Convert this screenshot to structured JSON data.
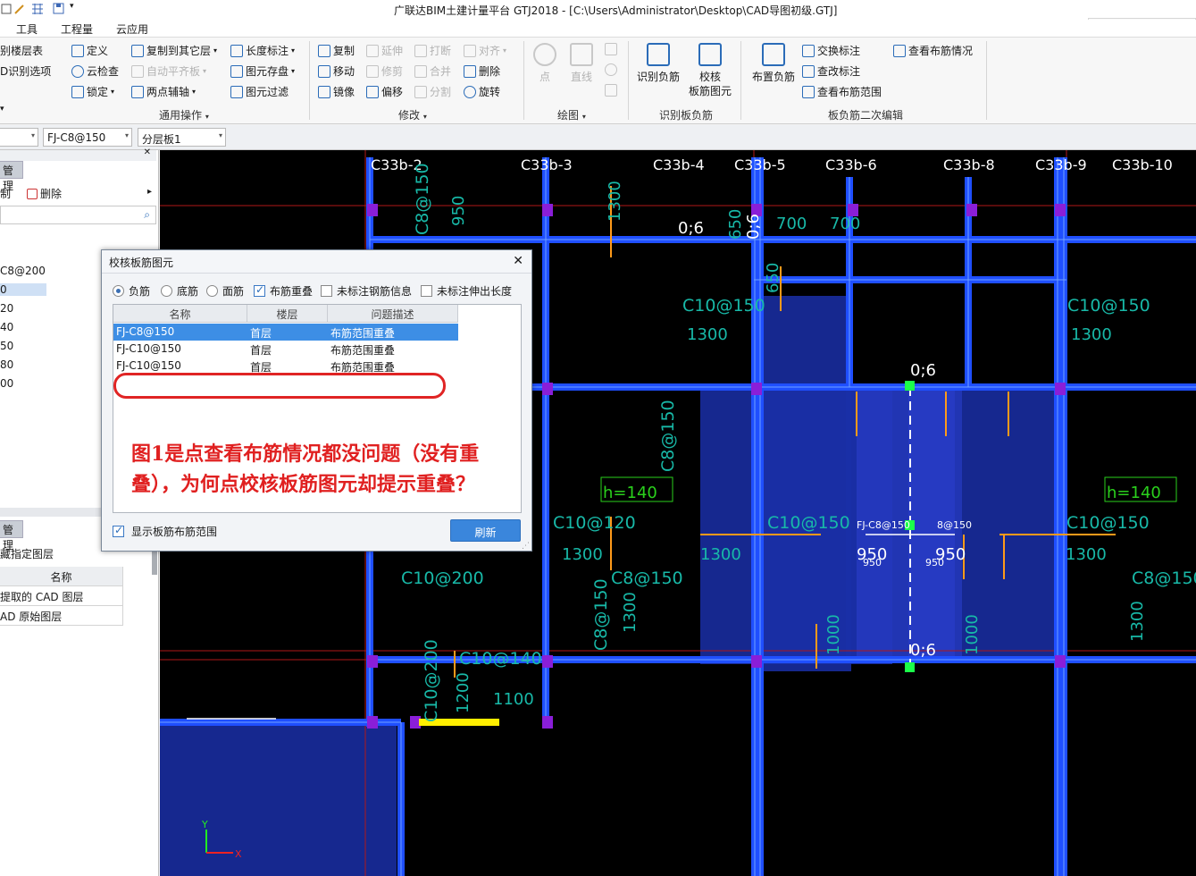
{
  "window": {
    "title": "广联达BIM土建计量平台 GTJ2018 - [C:\\Users\\Administrator\\Desktop\\CAD导图初级.GTJ]"
  },
  "menu": [
    "工具",
    "工程量",
    "云应用"
  ],
  "ribbon": {
    "left_cut": {
      "layer_table": "别楼层表",
      "cad_options": "D识别选项"
    },
    "common": {
      "define": "定义",
      "copy_to_other": "复制到其它层",
      "length_mark": "长度标注",
      "cloud_check": "云检查",
      "auto_level": "自动平齐板",
      "save_elements": "图元存盘",
      "lock": "锁定",
      "two_point_axis": "两点辅轴",
      "filter": "图元过滤",
      "group_label": "通用操作"
    },
    "modify": {
      "copy": "复制",
      "extend": "延伸",
      "break": "打断",
      "align": "对齐",
      "move": "移动",
      "trim": "修剪",
      "merge": "合并",
      "delete": "删除",
      "mirror": "镜像",
      "offset": "偏移",
      "split": "分割",
      "rotate": "旋转",
      "group_label": "修改"
    },
    "draw": {
      "point": "点",
      "line": "直线",
      "group_label": "绘图"
    },
    "identify": {
      "identify_neg": "识别负筋",
      "check_line1": "校核",
      "check_line2": "板筋图元",
      "group_label": "识别板负筋"
    },
    "secondary": {
      "place_neg": "布置负筋",
      "swap_mark": "交换标注",
      "view_layout": "查看布筋情况",
      "change_mark": "查改标注",
      "view_range": "查看布筋范围",
      "group_label": "板负筋二次编辑"
    }
  },
  "toolbar2": {
    "combo1": "",
    "combo2": "FJ-C8@150",
    "combo3": "分层板1"
  },
  "left_panel": {
    "manage_tab": "管理",
    "copy": "制",
    "delete": "删除",
    "list_items": [
      "C8@200",
      "0",
      "20",
      "40",
      "50",
      "80",
      "00"
    ],
    "selected_index": 1,
    "layer_manage_tab": "管理",
    "hide_layer": "藏指定图层",
    "grid_header": "名称",
    "grid_rows": [
      "提取的 CAD 图层",
      "AD 原始图层"
    ]
  },
  "canvas": {
    "axis_labels": [
      "C33b-2",
      "C33b-3",
      "C33b-4",
      "C33b-5",
      "C33b-6",
      "C33b-8",
      "C33b-9",
      "C33b-10"
    ],
    "labels": [
      "C8@150",
      "950",
      "1300",
      "0;6",
      "650",
      "700",
      "0;6",
      "650",
      "700",
      "C10@150",
      "1300",
      "C10@150",
      "1300",
      "0;6",
      "C8@150",
      "h=140",
      "h=140",
      "C10@120",
      "1300",
      "C10@150",
      "C10@150",
      "1300",
      "1300",
      "C10@200",
      "C8@150",
      "C8@150",
      "C8@150",
      "1300",
      "1300",
      "C10@140",
      "1100",
      "C10@200",
      "1200",
      "1000",
      "1000",
      "0;6",
      "950",
      "950",
      "FJ-C8@150",
      "8@150",
      "950",
      "950"
    ],
    "colors": {
      "background": "#000000",
      "beam": "#1f4fff",
      "slab_fill": "#1a2fa8",
      "purple": "#8a1ed8"
    },
    "axis_icon": {
      "y": "Y",
      "x": "X"
    }
  },
  "dialog": {
    "title": "校核板筋图元",
    "options": {
      "neg": "负筋",
      "bottom": "底筋",
      "face": "面筋",
      "overlap": "布筋重叠",
      "unmarked_info": "未标注钢筋信息",
      "unmarked_ext": "未标注伸出长度"
    },
    "option_states": {
      "radio_selected": "neg",
      "overlap_checked": true,
      "unmarked_info_checked": false,
      "unmarked_ext_checked": false
    },
    "headers": [
      "名称",
      "楼层",
      "问题描述"
    ],
    "rows": [
      {
        "name": "FJ-C8@150",
        "floor": "首层",
        "issue": "布筋范围重叠"
      },
      {
        "name": "FJ-C10@150",
        "floor": "首层",
        "issue": "布筋范围重叠"
      },
      {
        "name": "FJ-C10@150",
        "floor": "首层",
        "issue": "布筋范围重叠"
      }
    ],
    "selected_row": 0,
    "note": "图1是点查看布筋情况都没问题（没有重叠），为何点校核板筋图元却提示重叠？",
    "show_range": "显示板筋布筋范围",
    "show_range_checked": true,
    "refresh": "刷新"
  }
}
